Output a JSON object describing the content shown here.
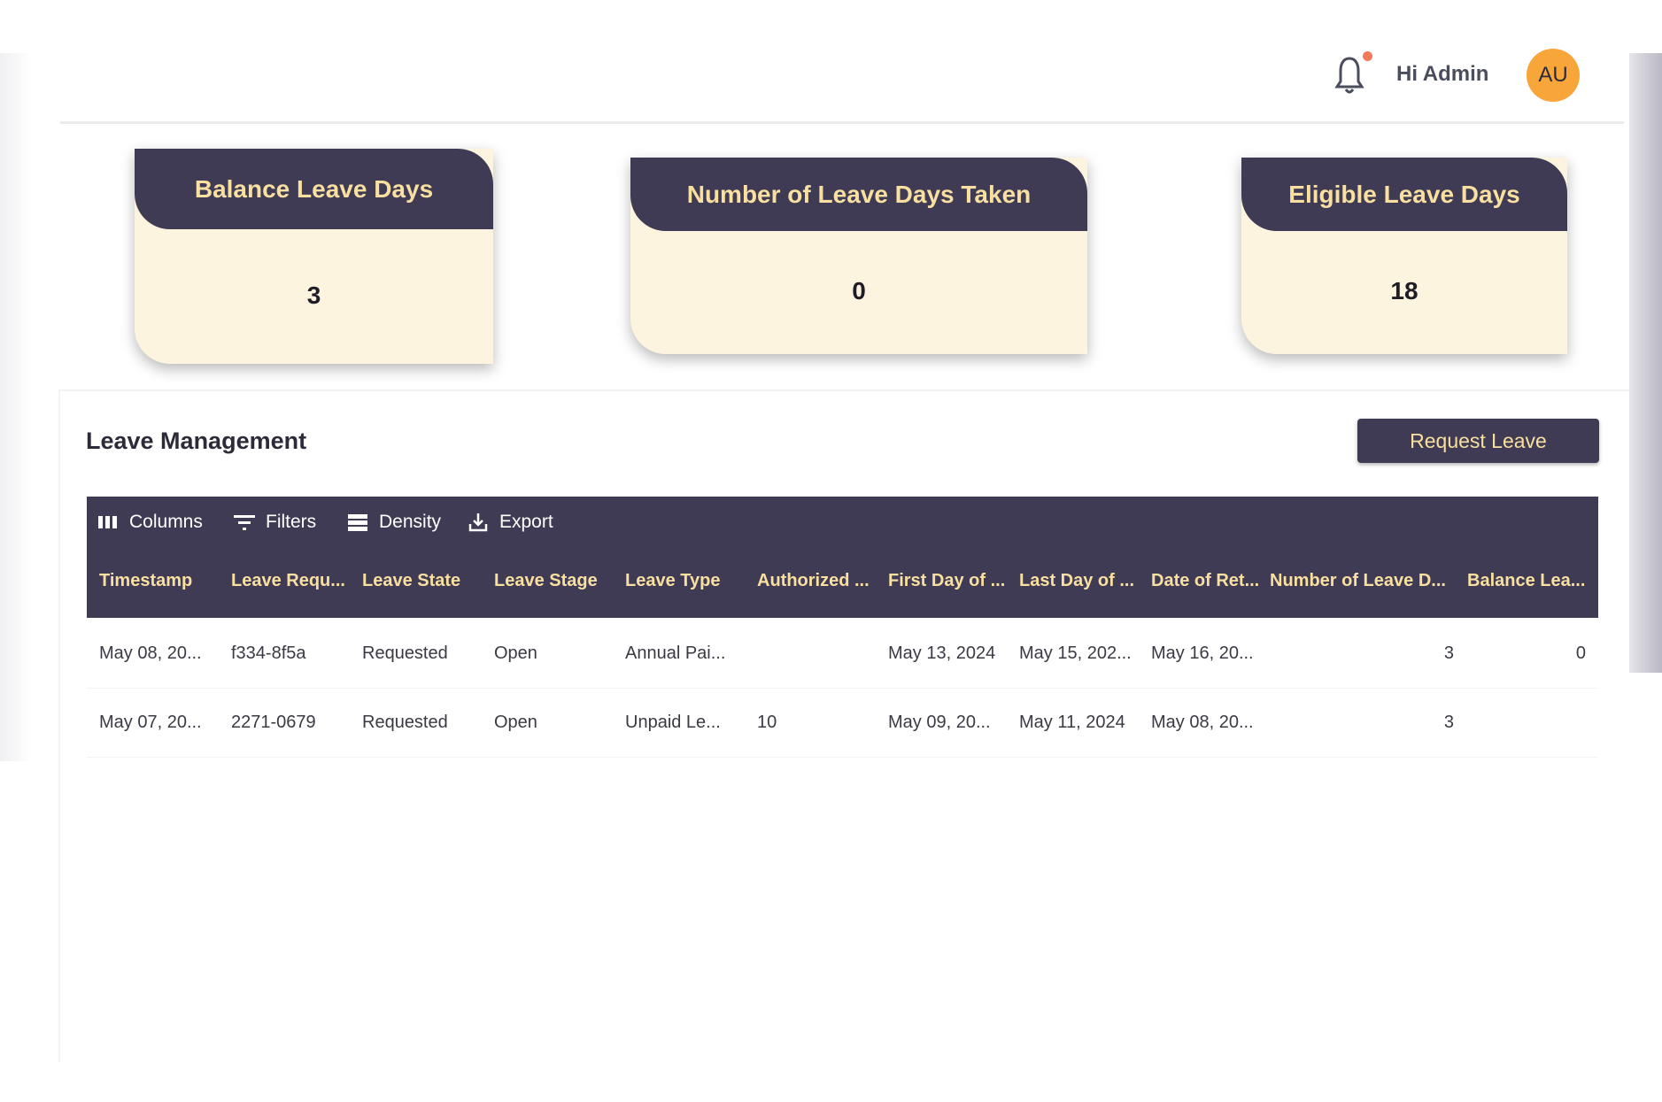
{
  "header": {
    "greeting": "Hi Admin",
    "avatar_initials": "AU",
    "notification_icon": "bell-icon"
  },
  "cards": [
    {
      "title": "Balance Leave Days",
      "value": "3"
    },
    {
      "title": "Number of Leave Days Taken",
      "value": "0"
    },
    {
      "title": "Eligible Leave Days",
      "value": "18"
    }
  ],
  "main": {
    "title": "Leave Management",
    "request_button": "Request Leave",
    "toolbar": {
      "columns": "Columns",
      "filters": "Filters",
      "density": "Density",
      "export": "Export"
    },
    "columns": [
      "Timestamp",
      "Leave Requ...",
      "Leave State",
      "Leave Stage",
      "Leave Type",
      "Authorized ...",
      "First Day of ...",
      "Last Day of ...",
      "Date of Ret...",
      "Number of Leave D...",
      "Balance Lea..."
    ],
    "rows": [
      [
        "May 08, 20...",
        "f334-8f5a",
        "Requested",
        "Open",
        "Annual Pai...",
        "",
        "May 13, 2024",
        "May 15, 202...",
        "May 16, 20...",
        "3",
        "0"
      ],
      [
        "May 07, 20...",
        "2271-0679",
        "Requested",
        "Open",
        "Unpaid Le...",
        "10",
        "May 09, 20...",
        "May 11, 2024",
        "May 08, 20...",
        "3",
        ""
      ]
    ]
  },
  "colors": {
    "primary_dark": "#3f3b54",
    "accent_text": "#f9dfa0",
    "card_body": "#fdf4df",
    "avatar": "#f8a53a",
    "notification_dot": "#f07a5a"
  }
}
